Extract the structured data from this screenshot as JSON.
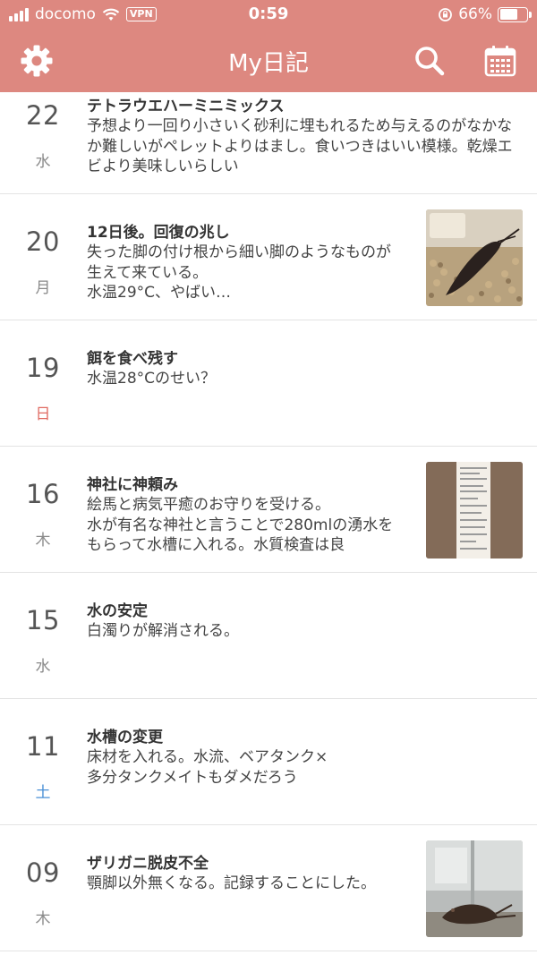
{
  "status_bar": {
    "carrier": "docomo",
    "vpn": "VPN",
    "time": "0:59",
    "battery": "66%",
    "battery_level": 0.66
  },
  "header": {
    "title": "My日記",
    "settings_icon": "gear-icon",
    "search_icon": "search-icon",
    "calendar_icon": "calendar-icon"
  },
  "colors": {
    "header_bg": "#dd8880",
    "sunday": "#e06b62",
    "saturday": "#4a90d6",
    "weekday": "#8a8a8a"
  },
  "entries": [
    {
      "day": "22",
      "weekday": "水",
      "title": "テトラウエハーミニミックス",
      "body": "予想より一回り小さいく砂利に埋もれるため与えるのがなかなか難しいがペレットよりはまし。食いつきはいい模様。乾燥エビより美味しいらしい"
    },
    {
      "day": "20",
      "weekday": "月",
      "title": "12日後。回復の兆し",
      "body": "失った脚の付け根から細い脚のようなものが生えて来ている。\n水温29°C、やばい…"
    },
    {
      "day": "19",
      "weekday": "日",
      "title": "餌を食べ残す",
      "body": "水温28°Cのせい？"
    },
    {
      "day": "16",
      "weekday": "木",
      "title": "神社に神頼み",
      "body": "絵馬と病気平癒のお守りを受ける。\n水が有名な神社と言うことで280mlの湧水をもらって水槽に入れる。水質検査は良"
    },
    {
      "day": "15",
      "weekday": "水",
      "title": "水の安定",
      "body": "白濁りが解消される。"
    },
    {
      "day": "11",
      "weekday": "土",
      "title": "水槽の変更",
      "body": "床材を入れる。水流、ベアタンク×\n多分タンクメイトもダメだろう"
    },
    {
      "day": "09",
      "weekday": "木",
      "title": "ザリガニ脱皮不全",
      "body": "顎脚以外無くなる。記録することにした。"
    }
  ]
}
